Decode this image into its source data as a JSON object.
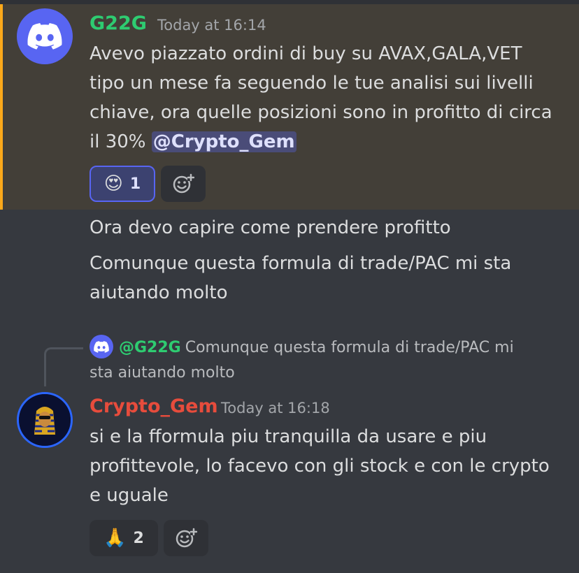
{
  "message1": {
    "username": "G22G",
    "username_color": "#2ecc71",
    "timestamp": "Today at 16:14",
    "avatar_icon": "discord-logo-icon",
    "text_lines": [
      "Avevo piazzato ordini di buy su AVAX,GALA,VET",
      "tipo un mese fa seguendo le tue analisi sui livelli",
      "chiave, ora quelle posizioni sono in profitto di circa",
      "il 30%"
    ],
    "mention": "@Crypto_Gem",
    "highlight_color": "#faa81a",
    "reaction": {
      "emoji": "😍",
      "count": "1"
    },
    "add_reaction_icon": "add-reaction-icon"
  },
  "followups": [
    "Ora devo capire come prendere profitto",
    "Comunque questa formula di trade/PAC mi sta",
    "aiutando molto"
  ],
  "reply": {
    "mention": "@G22G",
    "snippet": "Comunque questa formula di trade/PAC mi",
    "snippet2": "sta aiutando molto"
  },
  "message2": {
    "username": "Crypto_Gem",
    "username_color": "#e74c3c",
    "timestamp": "Today at 16:18",
    "avatar_icon": "pharaoh-avatar-icon",
    "text_lines": [
      "si e la fformula piu tranquilla da usare e piu",
      "profittevole, lo facevo con gli stock e con le crypto",
      "e uguale"
    ],
    "reaction": {
      "emoji": "🙏",
      "count": "2"
    },
    "add_reaction_icon": "add-reaction-icon"
  }
}
